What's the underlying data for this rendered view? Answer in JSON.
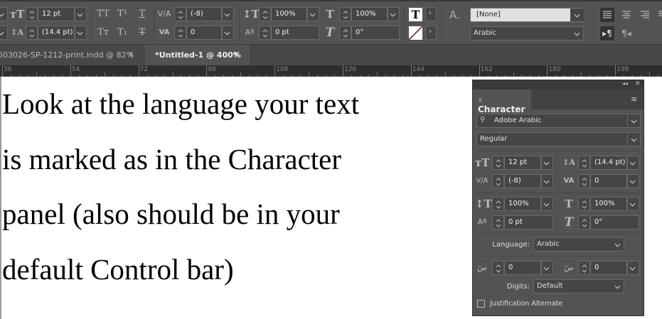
{
  "control_bar": {
    "font_size": "12 pt",
    "leading": "(14.4 pt)",
    "kerning": "(-8)",
    "tracking": "0",
    "vertical_scale": "100%",
    "baseline_shift": "0 pt",
    "horizontal_scale": "100%",
    "skew": "0°",
    "character_style": "[None]",
    "language": "Arabic",
    "char_style_icon": "A."
  },
  "tabs": [
    {
      "label": "603026-SP-1212-print.indd @ 82%",
      "active": false
    },
    {
      "label": "*Untitled-1 @ 400%",
      "active": true
    }
  ],
  "ruler": [
    "36",
    "54",
    "72",
    "90",
    "108",
    "126",
    "144",
    "162",
    "180",
    "198"
  ],
  "document_text": [
    "Look at the language your text",
    "is marked as in the Character",
    "panel (also should be in your",
    "default Control bar)"
  ],
  "panel": {
    "title": "Character",
    "font_family": "Adobe Arabic",
    "font_style": "Regular",
    "font_size": "12 pt",
    "leading": "(14.4 pt)",
    "kerning": "(-8)",
    "tracking": "0",
    "vertical_scale": "100%",
    "horizontal_scale": "100%",
    "baseline_shift": "0 pt",
    "skew": "0°",
    "language_label": "Language:",
    "language": "Arabic",
    "diacritic_x": "0",
    "diacritic_y": "0",
    "digits_label": "Digits:",
    "digits": "Default",
    "justification_alternate_label": "Justification Alternate",
    "justification_alternate_checked": false
  }
}
